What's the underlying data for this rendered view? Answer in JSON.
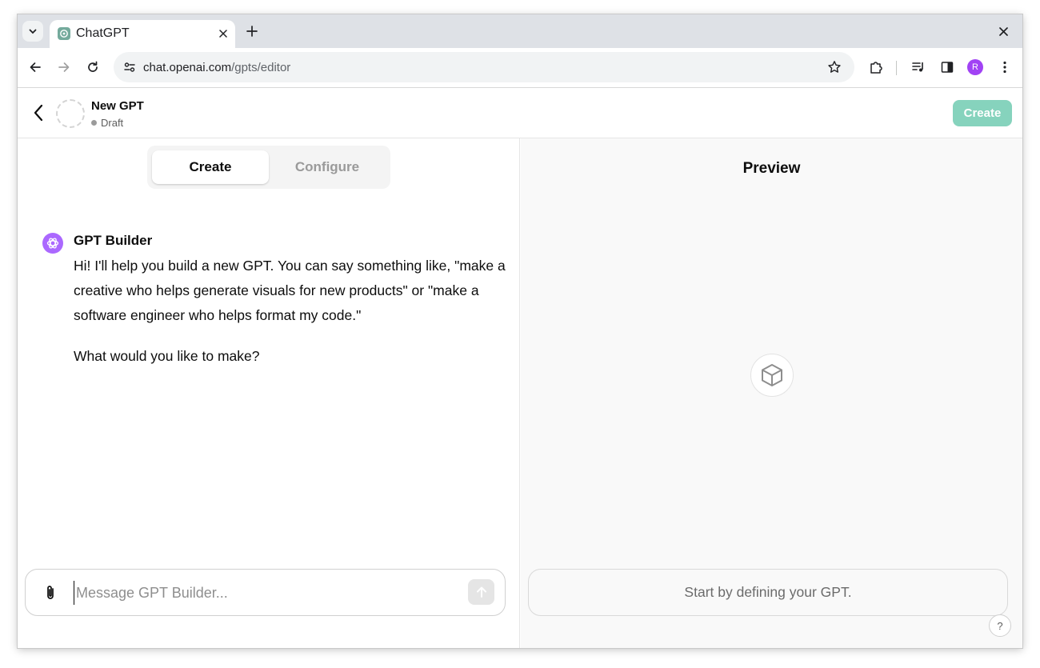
{
  "browser": {
    "tab_title": "ChatGPT",
    "url_domain": "chat.openai.com",
    "url_path": "/gpts/editor",
    "profile_initial": "R",
    "profile_color": "#a142f4"
  },
  "header": {
    "gpt_name": "New GPT",
    "status": "Draft",
    "create_label": "Create"
  },
  "left": {
    "tabs": [
      {
        "label": "Create",
        "active": true
      },
      {
        "label": "Configure",
        "active": false
      }
    ],
    "builder_name": "GPT Builder",
    "message_1": "Hi! I'll help you build a new GPT. You can say something like, \"make a creative who helps generate visuals for new products\" or \"make a software engineer who helps format my code.\"",
    "message_2": "What would you like to make?",
    "input_placeholder": "Message GPT Builder..."
  },
  "right": {
    "title": "Preview",
    "input_placeholder": "Start by defining your GPT.",
    "help_label": "?"
  },
  "colors": {
    "create_button": "#86d3bd",
    "builder_avatar": "#ab68ff"
  }
}
